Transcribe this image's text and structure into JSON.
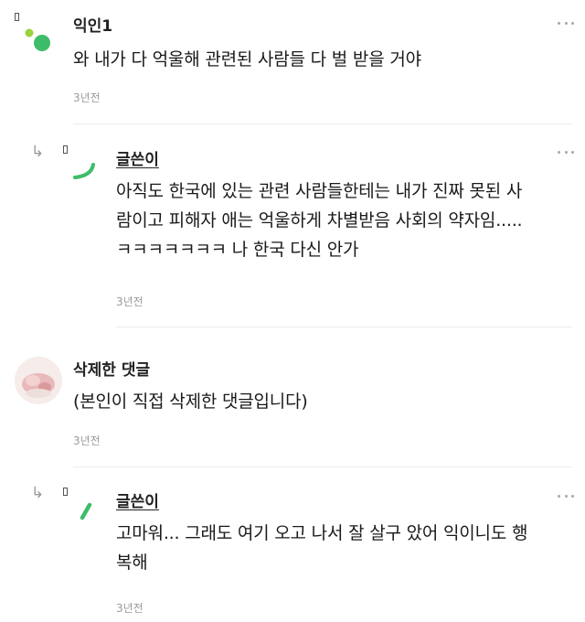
{
  "comments": [
    {
      "name": "익인1",
      "text": "와 내가 다 억울해 관련된 사람들 다 벌 받을 거야",
      "time": "3년전",
      "more_icon": "more-horizontal-icon",
      "avatar_icon": "green-dots-avatar-icon"
    },
    {
      "reply_icon": "reply-arrow-icon",
      "name": "글쓴이",
      "text": "아직도 한국에 있는 관련 사람들한테는 내가 진짜 못된 사\n람이고 피해자 애는 억울하게 차별받음 사회의 약자임.....\nㅋㅋㅋㅋㅋㅋㅋ 나 한국 다신 안가",
      "time": "3년전",
      "more_icon": "more-horizontal-icon",
      "avatar_icon": "green-arc-avatar-icon"
    },
    {
      "name": "삭제한 댓글",
      "text": "(본인이 직접 삭제한 댓글입니다)",
      "time": "3년전",
      "avatar_icon": "pink-photo-avatar-icon"
    },
    {
      "reply_icon": "reply-arrow-icon",
      "name": "글쓴이",
      "text": "고마워... 그래도 여기 오고 나서 잘 살구 았어 익이니도 행\n복해",
      "time": "3년전",
      "more_icon": "more-horizontal-icon",
      "avatar_icon": "green-stroke-avatar-icon"
    }
  ],
  "colors": {
    "avatar_green": "#3dbd6a",
    "avatar_lime": "#9ad23b",
    "avatar_pink": "#e9b9b9",
    "muted_text": "#9a9a9a",
    "divider": "#ececec"
  }
}
